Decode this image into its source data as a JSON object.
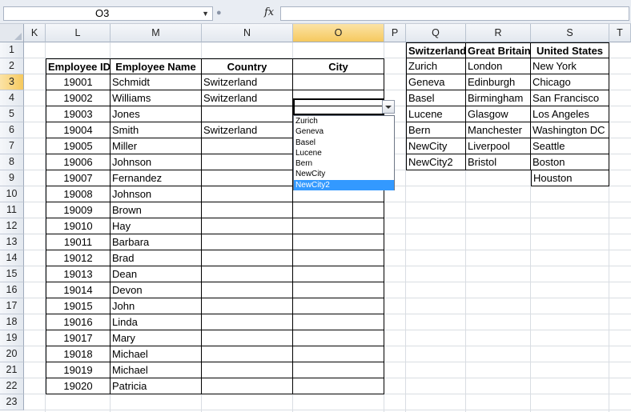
{
  "formula_bar": {
    "name_box": "O3",
    "fx_label": "fx",
    "formula": ""
  },
  "columns": [
    "K",
    "L",
    "M",
    "N",
    "O",
    "P",
    "Q",
    "R",
    "S",
    "T"
  ],
  "selected_column": "O",
  "rows": [
    "1",
    "2",
    "3",
    "4",
    "5",
    "6",
    "7",
    "8",
    "9",
    "10",
    "11",
    "12",
    "13",
    "14",
    "15",
    "16",
    "17",
    "18",
    "19",
    "20",
    "21",
    "22",
    "23"
  ],
  "selected_row": "3",
  "employee_table": {
    "headers": [
      "Employee ID",
      "Employee Name",
      "Country",
      "City"
    ],
    "rows": [
      [
        "19001",
        "Schmidt",
        "Switzerland",
        ""
      ],
      [
        "19002",
        "Williams",
        "Switzerland",
        ""
      ],
      [
        "19003",
        "Jones",
        "",
        ""
      ],
      [
        "19004",
        "Smith",
        "Switzerland",
        ""
      ],
      [
        "19005",
        "Miller",
        "",
        ""
      ],
      [
        "19006",
        "Johnson",
        "",
        ""
      ],
      [
        "19007",
        "Fernandez",
        "",
        ""
      ],
      [
        "19008",
        "Johnson",
        "",
        ""
      ],
      [
        "19009",
        "Brown",
        "",
        ""
      ],
      [
        "19010",
        "Hay",
        "",
        ""
      ],
      [
        "19011",
        "Barbara",
        "",
        ""
      ],
      [
        "19012",
        "Brad",
        "",
        ""
      ],
      [
        "19013",
        "Dean",
        "",
        ""
      ],
      [
        "19014",
        "Devon",
        "",
        ""
      ],
      [
        "19015",
        "John",
        "",
        ""
      ],
      [
        "19016",
        "Linda",
        "",
        ""
      ],
      [
        "19017",
        "Mary",
        "",
        ""
      ],
      [
        "19018",
        "Michael",
        "",
        ""
      ],
      [
        "19019",
        "Michael",
        "",
        ""
      ],
      [
        "19020",
        "Patricia",
        "",
        ""
      ]
    ]
  },
  "lookup_table": {
    "headers": [
      "Switzerland",
      "Great Britain",
      "United States"
    ],
    "rows": [
      [
        "Zurich",
        "London",
        "New York"
      ],
      [
        "Geneva",
        "Edinburgh",
        "Chicago"
      ],
      [
        "Basel",
        "Birmingham",
        "San Francisco"
      ],
      [
        "Lucene",
        "Glasgow",
        "Los Angeles"
      ],
      [
        "Bern",
        "Manchester",
        "Washington DC"
      ],
      [
        "NewCity",
        "Liverpool",
        "Seattle"
      ],
      [
        "NewCity2",
        "Bristol",
        "Boston"
      ],
      [
        "",
        "",
        "Houston"
      ]
    ]
  },
  "dropdown": {
    "items": [
      "Zurich",
      "Geneva",
      "Basel",
      "Lucene",
      "Bern",
      "NewCity",
      "NewCity2"
    ],
    "highlighted": "NewCity2"
  },
  "colors": {
    "highlight": "#3399ff",
    "selected_header": "#f6c95e"
  }
}
